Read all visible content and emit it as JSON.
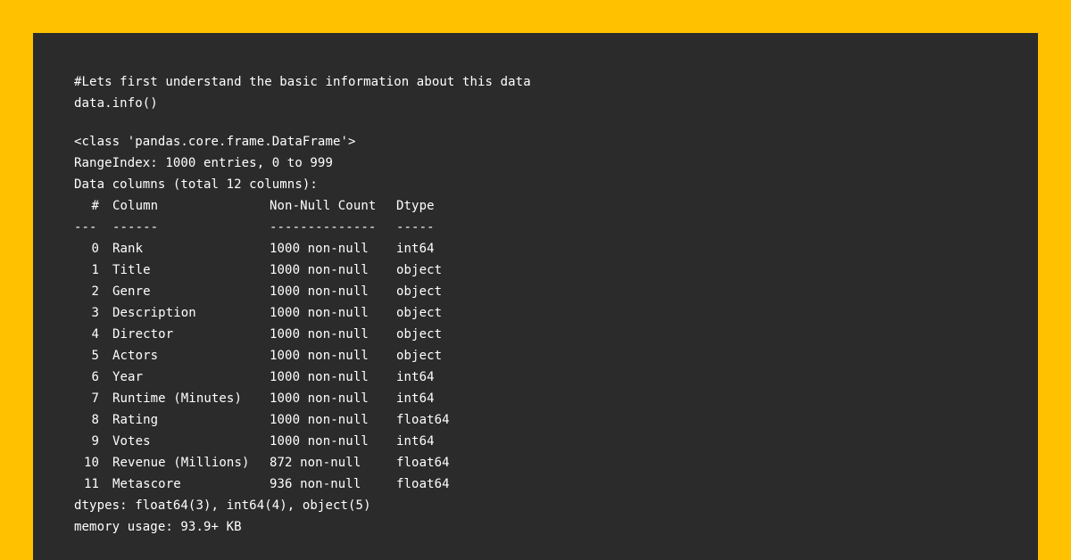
{
  "code": {
    "comment": "#Lets first understand the basic information about this data",
    "call": "data.info()"
  },
  "output": {
    "class_line": "<class 'pandas.core.frame.DataFrame'>",
    "range_index": "RangeIndex: 1000 entries, 0 to 999",
    "data_columns": "Data columns (total 12 columns):",
    "header": {
      "idx": "#",
      "column": "Column",
      "count": "Non-Null Count",
      "dtype": "Dtype"
    },
    "separator": {
      "idx": "---",
      "column": "------",
      "count": "--------------",
      "dtype": "-----"
    },
    "rows": [
      {
        "idx": "0",
        "column": "Rank",
        "count": "1000 non-null",
        "dtype": "int64"
      },
      {
        "idx": "1",
        "column": "Title",
        "count": "1000 non-null",
        "dtype": "object"
      },
      {
        "idx": "2",
        "column": "Genre",
        "count": "1000 non-null",
        "dtype": "object"
      },
      {
        "idx": "3",
        "column": "Description",
        "count": "1000 non-null",
        "dtype": "object"
      },
      {
        "idx": "4",
        "column": "Director",
        "count": "1000 non-null",
        "dtype": "object"
      },
      {
        "idx": "5",
        "column": "Actors",
        "count": "1000 non-null",
        "dtype": "object"
      },
      {
        "idx": "6",
        "column": "Year",
        "count": "1000 non-null",
        "dtype": "int64"
      },
      {
        "idx": "7",
        "column": "Runtime (Minutes)",
        "count": "1000 non-null",
        "dtype": "int64"
      },
      {
        "idx": "8",
        "column": "Rating",
        "count": "1000 non-null",
        "dtype": "float64"
      },
      {
        "idx": "9",
        "column": "Votes",
        "count": "1000 non-null",
        "dtype": "int64"
      },
      {
        "idx": "10",
        "column": "Revenue (Millions)",
        "count": "872 non-null",
        "dtype": "float64"
      },
      {
        "idx": "11",
        "column": "Metascore",
        "count": "936 non-null",
        "dtype": "float64"
      }
    ],
    "dtypes": "dtypes: float64(3), int64(4), object(5)",
    "memory": "memory usage: 93.9+ KB"
  },
  "colors": {
    "background": "#FFC100",
    "panel": "#2B2B2B",
    "text": "#FFFFFF"
  }
}
